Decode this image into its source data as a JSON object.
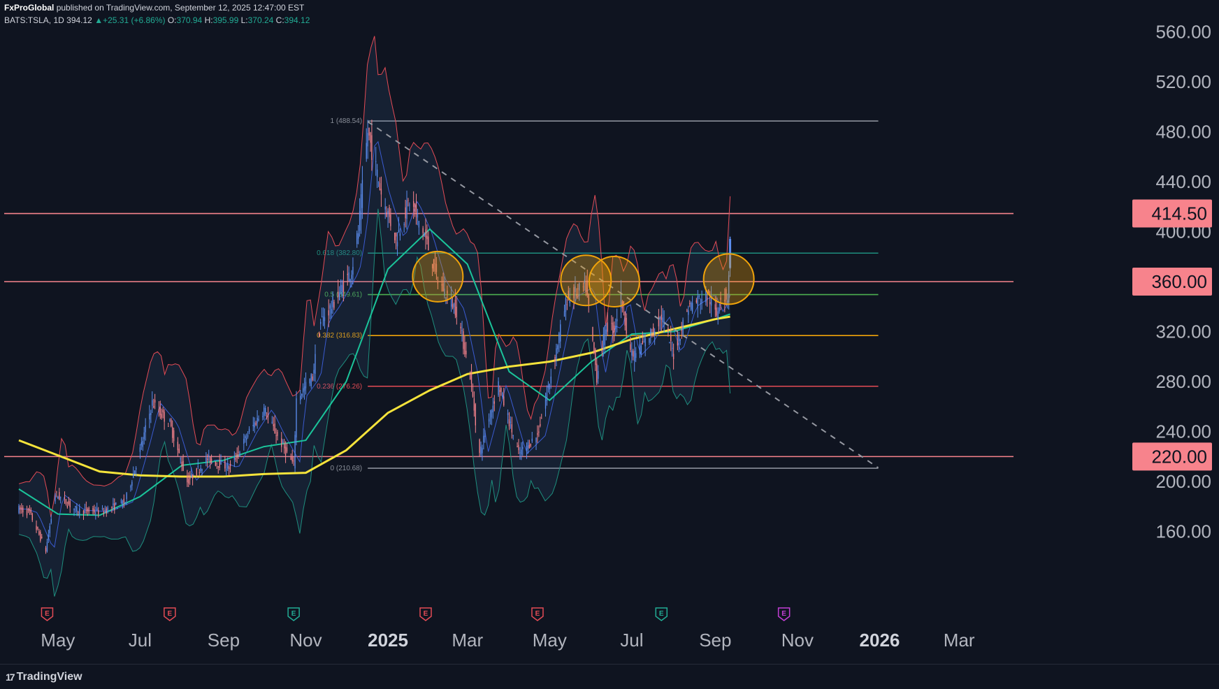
{
  "header": {
    "author": "FxProGlobal",
    "published_text": "published on TradingView.com, September 12, 2025 12:47:00 EST",
    "symbol": "BATS:TSLA, 1D",
    "last": "394.12",
    "change_arrow": "▲",
    "change": "+25.31 (+6.86%)",
    "o_label": "O:",
    "o": "370.94",
    "h_label": "H:",
    "h": "395.99",
    "l_label": "L:",
    "l": "370.24",
    "c_label": "C:",
    "c": "394.12"
  },
  "footer": {
    "brand": "TradingView",
    "logo_glyph": "17"
  },
  "colors": {
    "background": "#0f1420",
    "up": "#5b8def",
    "down": "#f7838c",
    "sma200": "#f5e33b",
    "sma50": "#1bc49a",
    "bollinger": "#e34b55",
    "horizontal_level": "#f7838c",
    "fib_1": "#8a8f99",
    "fib_618": "#1e8e7e",
    "fib_5": "#4caf50",
    "fib_382": "#f0a30a",
    "fib_236": "#e34b55",
    "circle": "#f0a30a"
  },
  "chart_data": {
    "type": "candlestick",
    "symbol": "BATS:TSLA",
    "interval": "1D",
    "y_ticks": [
      "560.00",
      "520.00",
      "480.00",
      "440.00",
      "400.00",
      "320.00",
      "280.00",
      "240.00",
      "200.00",
      "160.00"
    ],
    "x_ticks": [
      "May",
      "Jul",
      "Sep",
      "Nov",
      "2025",
      "Mar",
      "May",
      "Jul",
      "Sep",
      "Nov",
      "2026",
      "Mar"
    ],
    "ylim": [
      138,
      563
    ],
    "price_labels": [
      "414.50",
      "360.00",
      "220.00"
    ],
    "horizontal_levels": [
      414.5,
      360.0,
      220.0
    ],
    "fibonacci": {
      "start_date": "2024-12-17",
      "end_date": "2025-12-31",
      "levels": [
        {
          "ratio": "1",
          "price": 488.54,
          "label": "1 (488.54)"
        },
        {
          "ratio": "0.618",
          "price": 382.8,
          "label": "0.618 (382.80)"
        },
        {
          "ratio": "0.5",
          "price": 349.61,
          "label": "0.5 (349.61)"
        },
        {
          "ratio": "0.382",
          "price": 316.83,
          "label": "0.382 (316.83)"
        },
        {
          "ratio": "0.236",
          "price": 276.26,
          "label": "0.236 (276.26)"
        },
        {
          "ratio": "0",
          "price": 210.68,
          "label": "0 (210.68)"
        }
      ]
    },
    "trendline": {
      "from": {
        "date": "2024-12-17",
        "price": 488
      },
      "to": {
        "date": "2025-12-31",
        "price": 211
      }
    },
    "earnings_markers": [
      {
        "date": "2024-04-23",
        "type": "E",
        "result": "miss"
      },
      {
        "date": "2024-07-23",
        "type": "E",
        "result": "miss"
      },
      {
        "date": "2024-10-23",
        "type": "E",
        "result": "beat"
      },
      {
        "date": "2025-01-29",
        "type": "E",
        "result": "miss"
      },
      {
        "date": "2025-04-22",
        "type": "E",
        "result": "miss"
      },
      {
        "date": "2025-07-23",
        "type": "E",
        "result": "beat"
      },
      {
        "date": "2025-10-22",
        "type": "E",
        "result": "upcoming"
      }
    ],
    "circled_zones": [
      {
        "date": "2025-02-07",
        "price": 364
      },
      {
        "date": "2025-05-28",
        "price": 361
      },
      {
        "date": "2025-06-18",
        "price": 360
      },
      {
        "date": "2025-09-11",
        "price": 362
      }
    ],
    "price_path": [
      [
        "2024-04-02",
        178
      ],
      [
        "2024-04-10",
        175
      ],
      [
        "2024-04-22",
        145
      ],
      [
        "2024-04-29",
        190
      ],
      [
        "2024-05-15",
        177
      ],
      [
        "2024-06-03",
        176
      ],
      [
        "2024-06-20",
        184
      ],
      [
        "2024-07-02",
        229
      ],
      [
        "2024-07-10",
        263
      ],
      [
        "2024-07-23",
        246
      ],
      [
        "2024-08-05",
        200
      ],
      [
        "2024-08-20",
        218
      ],
      [
        "2024-09-06",
        211
      ],
      [
        "2024-09-20",
        240
      ],
      [
        "2024-10-01",
        258
      ],
      [
        "2024-10-10",
        238
      ],
      [
        "2024-10-23",
        213
      ],
      [
        "2024-10-25",
        266
      ],
      [
        "2024-11-06",
        284
      ],
      [
        "2024-11-12",
        328
      ],
      [
        "2024-11-20",
        340
      ],
      [
        "2024-12-05",
        369
      ],
      [
        "2024-12-10",
        400
      ],
      [
        "2024-12-17",
        480
      ],
      [
        "2024-12-27",
        431
      ],
      [
        "2025-01-07",
        394
      ],
      [
        "2025-01-17",
        425
      ],
      [
        "2025-01-28",
        398
      ],
      [
        "2025-02-07",
        361
      ],
      [
        "2025-02-21",
        337
      ],
      [
        "2025-03-03",
        285
      ],
      [
        "2025-03-10",
        222
      ],
      [
        "2025-03-24",
        278
      ],
      [
        "2025-04-08",
        222
      ],
      [
        "2025-04-22",
        237
      ],
      [
        "2025-05-01",
        280
      ],
      [
        "2025-05-14",
        347
      ],
      [
        "2025-05-28",
        356
      ],
      [
        "2025-06-05",
        284
      ],
      [
        "2025-06-12",
        325
      ],
      [
        "2025-06-18",
        322
      ],
      [
        "2025-06-23",
        348
      ],
      [
        "2025-07-01",
        300
      ],
      [
        "2025-07-10",
        310
      ],
      [
        "2025-07-23",
        332
      ],
      [
        "2025-08-01",
        302
      ],
      [
        "2025-08-12",
        340
      ],
      [
        "2025-08-26",
        350
      ],
      [
        "2025-09-02",
        333
      ],
      [
        "2025-09-05",
        350
      ],
      [
        "2025-09-10",
        347
      ],
      [
        "2025-09-11",
        368
      ],
      [
        "2025-09-12",
        394
      ]
    ],
    "sma200_path": [
      [
        "2024-04-02",
        233
      ],
      [
        "2024-05-01",
        221
      ],
      [
        "2024-06-01",
        208
      ],
      [
        "2024-07-01",
        205
      ],
      [
        "2024-08-01",
        204
      ],
      [
        "2024-09-01",
        204
      ],
      [
        "2024-10-01",
        206
      ],
      [
        "2024-11-01",
        207
      ],
      [
        "2024-12-01",
        225
      ],
      [
        "2025-01-01",
        255
      ],
      [
        "2025-02-01",
        273
      ],
      [
        "2025-03-01",
        286
      ],
      [
        "2025-04-01",
        292
      ],
      [
        "2025-05-01",
        296
      ],
      [
        "2025-06-01",
        303
      ],
      [
        "2025-07-01",
        314
      ],
      [
        "2025-08-01",
        322
      ],
      [
        "2025-09-01",
        330
      ],
      [
        "2025-09-12",
        332
      ]
    ],
    "sma50_path": [
      [
        "2024-04-02",
        194
      ],
      [
        "2024-05-01",
        174
      ],
      [
        "2024-06-01",
        173
      ],
      [
        "2024-07-01",
        188
      ],
      [
        "2024-08-01",
        213
      ],
      [
        "2024-09-01",
        217
      ],
      [
        "2024-10-01",
        228
      ],
      [
        "2024-11-01",
        233
      ],
      [
        "2024-12-01",
        280
      ],
      [
        "2025-01-01",
        370
      ],
      [
        "2025-02-01",
        402
      ],
      [
        "2025-03-01",
        374
      ],
      [
        "2025-04-01",
        288
      ],
      [
        "2025-05-01",
        265
      ],
      [
        "2025-06-01",
        296
      ],
      [
        "2025-07-01",
        318
      ],
      [
        "2025-08-01",
        320
      ],
      [
        "2025-09-01",
        330
      ],
      [
        "2025-09-12",
        334
      ]
    ]
  }
}
